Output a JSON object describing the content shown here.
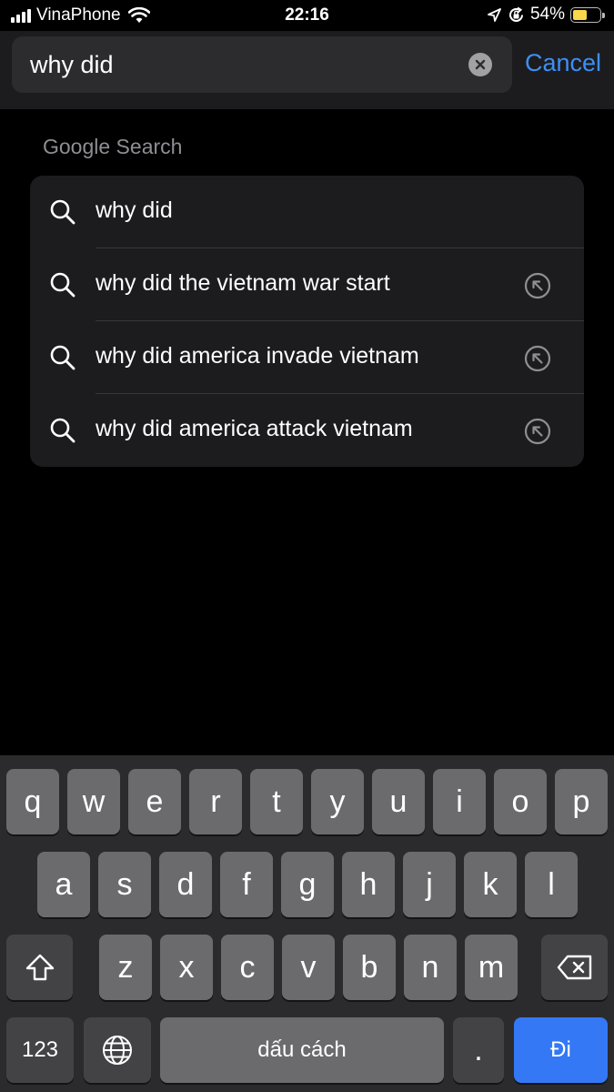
{
  "status_bar": {
    "carrier": "VinaPhone",
    "time": "22:16",
    "battery_percent": "54%",
    "battery_level": 0.54,
    "signal_bars": 4
  },
  "search": {
    "query": "why did",
    "cancel_label": "Cancel"
  },
  "suggestions": {
    "section_title": "Google Search",
    "items": [
      {
        "label": "why did",
        "has_fill_arrow": false
      },
      {
        "label": "why did the vietnam war start",
        "has_fill_arrow": true
      },
      {
        "label": "why did america invade vietnam",
        "has_fill_arrow": true
      },
      {
        "label": "why did america attack vietnam",
        "has_fill_arrow": true
      }
    ]
  },
  "keyboard": {
    "row1": [
      "q",
      "w",
      "e",
      "r",
      "t",
      "y",
      "u",
      "i",
      "o",
      "p"
    ],
    "row2": [
      "a",
      "s",
      "d",
      "f",
      "g",
      "h",
      "j",
      "k",
      "l"
    ],
    "row3": [
      "z",
      "x",
      "c",
      "v",
      "b",
      "n",
      "m"
    ],
    "numbers_label": "123",
    "space_label": "dấu cách",
    "period_label": ".",
    "return_label": "Đi",
    "icons": {
      "shift": "shift-icon",
      "globe": "globe-icon",
      "backspace": "backspace-icon"
    }
  },
  "colors": {
    "accent": "#3d8ff5",
    "return_key": "#3478f6",
    "battery_fill": "#f9d64a"
  }
}
